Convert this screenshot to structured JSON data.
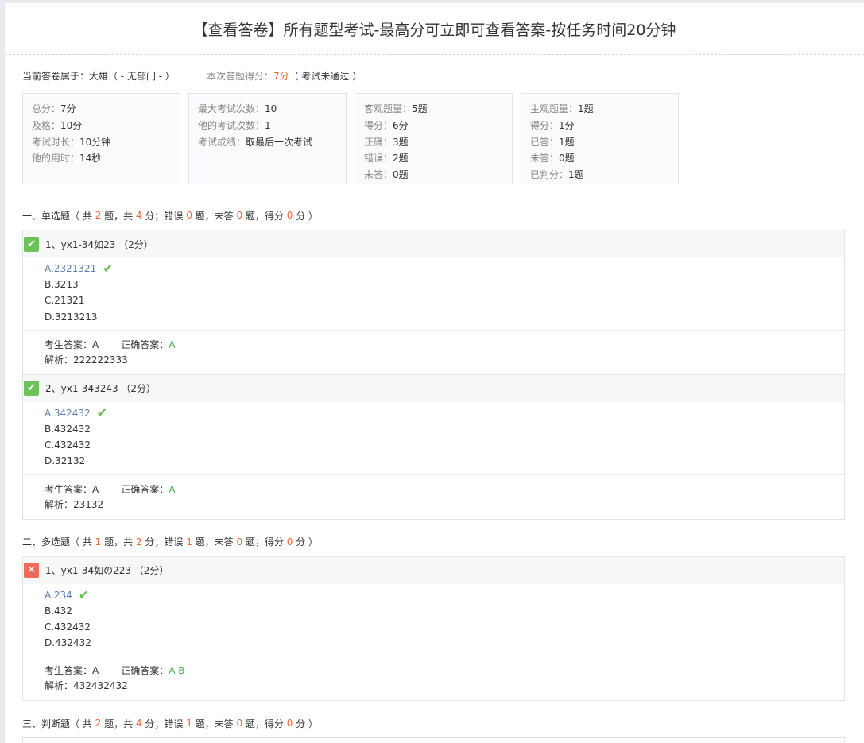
{
  "title": "【查看答卷】所有题型考试-最高分可立即可查看答案-按任务时间20分钟",
  "owner": {
    "label": "当前答卷属于：",
    "name": "大雄（ - 无部门 - ）",
    "score_label": "本次答题得分：",
    "score": "7分",
    "result": "（ 考试未通过 ）"
  },
  "cards": [
    {
      "rows": [
        {
          "label": "总分：",
          "value": "7分"
        },
        {
          "label": "及格：",
          "value": "10分"
        },
        {
          "label": "考试时长：",
          "value": "10分钟"
        },
        {
          "label": "他的用时：",
          "value": "14秒"
        }
      ]
    },
    {
      "rows": [
        {
          "label": "最大考试次数：",
          "value": "10"
        },
        {
          "label": "他的考试次数：",
          "value": "1"
        },
        {
          "label": "考试成绩：",
          "value": "取最后一次考试"
        }
      ]
    },
    {
      "rows": [
        {
          "label": "客观题量：",
          "value": "5题"
        },
        {
          "label": "得分：",
          "value": "6分"
        },
        {
          "label": "正确：",
          "value": "3题"
        },
        {
          "label": "错误：",
          "value": "2题"
        },
        {
          "label": "未答：",
          "value": "0题"
        }
      ]
    },
    {
      "rows": [
        {
          "label": "主观题量：",
          "value": "1题"
        },
        {
          "label": "得分：",
          "value": "1分"
        },
        {
          "label": "已答：",
          "value": "1题"
        },
        {
          "label": "未答：",
          "value": "0题"
        },
        {
          "label": "已判分：",
          "value": "1题"
        }
      ]
    }
  ],
  "sections": [
    {
      "name": "一、单选题",
      "p1": "（ 共 ",
      "count": "2",
      "p2": " 题，共 ",
      "points": "4",
      "p3": " 分；错误 ",
      "wrong": "0",
      "p4": " 题，未答 ",
      "unanswered": "0",
      "p5": " 题，得分 ",
      "score": "0",
      "p6": " 分 ）",
      "questions": [
        {
          "status": "correct",
          "status_glyph": "✔",
          "text": "1、yx1-34如23 （2分）",
          "options": [
            "A.2321321",
            "B.3213",
            "C.21321",
            "D.3213213"
          ],
          "student_label": "考生答案：",
          "student": "A",
          "correct_label": "正确答案：",
          "correct": "A",
          "analysis_label": "解析：",
          "analysis": "222222333"
        },
        {
          "status": "correct",
          "status_glyph": "✔",
          "text": "2、yx1-343243 （2分）",
          "options": [
            "A.342432",
            "B.432432",
            "C.432432",
            "D.32132"
          ],
          "student_label": "考生答案：",
          "student": "A",
          "correct_label": "正确答案：",
          "correct": "A",
          "analysis_label": "解析：",
          "analysis": "23132"
        }
      ]
    },
    {
      "name": "二、多选题",
      "p1": "（ 共 ",
      "count": "1",
      "p2": " 题，共 ",
      "points": "2",
      "p3": " 分；错误 ",
      "wrong": "1",
      "p4": " 题，未答 ",
      "unanswered": "0",
      "p5": " 题，得分 ",
      "score": "0",
      "p6": " 分 ）",
      "questions": [
        {
          "status": "wrong",
          "status_glyph": "✕",
          "text": "1、yx1-34如の223 （2分）",
          "options": [
            "A.234",
            "B.432",
            "C.432432",
            "D.432432"
          ],
          "student_label": "考生答案：",
          "student": "A",
          "correct_label": "正确答案：",
          "correct": "A B",
          "analysis_label": "解析：",
          "analysis": "432432432"
        }
      ]
    },
    {
      "name": "三、判断题",
      "p1": "（ 共 ",
      "count": "2",
      "p2": " 题，共 ",
      "points": "4",
      "p3": " 分；错误 ",
      "wrong": "1",
      "p4": " 题，未答 ",
      "unanswered": "0",
      "p5": " 题，得分 ",
      "score": "0",
      "p6": " 分 ）",
      "questions": []
    }
  ],
  "tick_glyph": "✔"
}
